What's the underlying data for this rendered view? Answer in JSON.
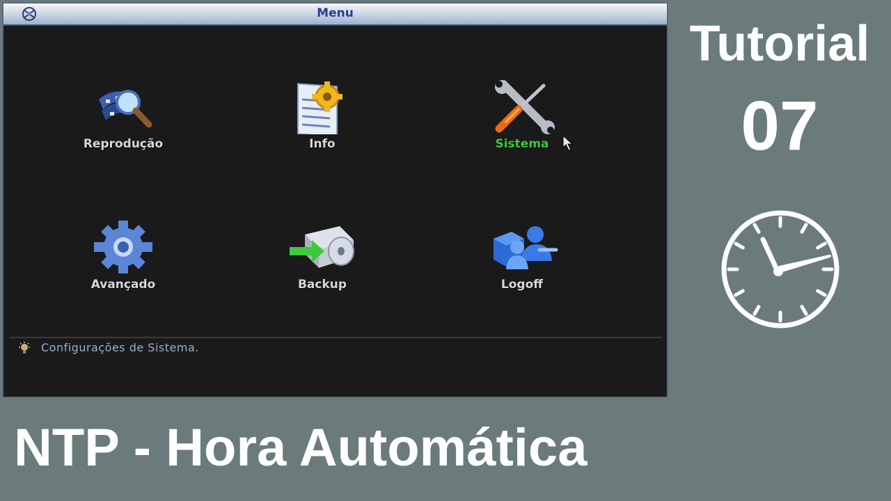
{
  "window": {
    "title": "Menu",
    "logo_icon": "dvr-logo-icon"
  },
  "menu": {
    "items": [
      {
        "label": "Reprodução",
        "icon": "playback-film-magnifier-icon",
        "selected": false
      },
      {
        "label": "Info",
        "icon": "info-document-gear-icon",
        "selected": false
      },
      {
        "label": "Sistema",
        "icon": "system-wrench-screwdriver-icon",
        "selected": true
      },
      {
        "label": "Avançado",
        "icon": "advanced-gear-icon",
        "selected": false
      },
      {
        "label": "Backup",
        "icon": "backup-disc-icon",
        "selected": false
      },
      {
        "label": "Logoff",
        "icon": "logoff-users-icon",
        "selected": false
      }
    ],
    "selected_color": "#3cc93c"
  },
  "status": {
    "hint": "Configurações de Sistema.",
    "icon": "lightbulb-icon"
  },
  "tutorial": {
    "word": "Tutorial",
    "number": "07",
    "icon": "clock-icon"
  },
  "caption": "NTP - Hora Automática"
}
